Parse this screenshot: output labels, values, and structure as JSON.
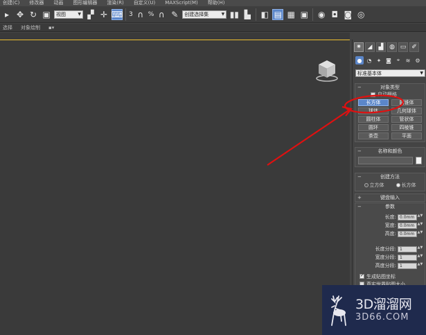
{
  "menubar": {
    "items": [
      "创建(C)",
      "修改器",
      "动画",
      "图形编辑器",
      "渲染(R)",
      "自定义(U)",
      "MAXScript(M)",
      "帮助(H)"
    ]
  },
  "toolbar": {
    "view_select": "视图",
    "selection_set": "创建选择集",
    "snap_label": "3",
    "percent_label": "%"
  },
  "ribbon": {
    "items": [
      "选择",
      "对象绘制"
    ]
  },
  "panel": {
    "category_dropdown": "标准基本体",
    "object_type": {
      "title": "对象类型",
      "autogrid_label": "自动栅格",
      "buttons": [
        "长方体",
        "圆锥体",
        "球体",
        "几何球体",
        "圆柱体",
        "管状体",
        "圆环",
        "四棱锥",
        "茶壶",
        "平面"
      ]
    },
    "name_color": {
      "title": "名称和颜色"
    },
    "creation_method": {
      "title": "创建方法",
      "option_cube": "立方体",
      "option_box": "长方体"
    },
    "keyboard_entry": {
      "title": "键盘输入"
    },
    "parameters": {
      "title": "参数",
      "length_label": "长度:",
      "length_value": "0.0mm",
      "width_label": "宽度:",
      "width_value": "0.0mm",
      "height_label": "高度:",
      "height_value": "0.0mm",
      "length_segs_label": "长度分段:",
      "length_segs_value": "1",
      "width_segs_label": "宽度分段:",
      "width_segs_value": "1",
      "height_segs_label": "高度分段:",
      "height_segs_value": "1",
      "gen_mapping_label": "生成贴图坐标",
      "real_world_label": "真实世界贴图大小"
    }
  },
  "watermark": {
    "main": "3D溜溜网",
    "sub": "3D66.COM"
  },
  "colors": {
    "accent_blue": "#5b86c9",
    "annotation_red": "#e01010",
    "viewport_bg": "#3a3a3a"
  }
}
